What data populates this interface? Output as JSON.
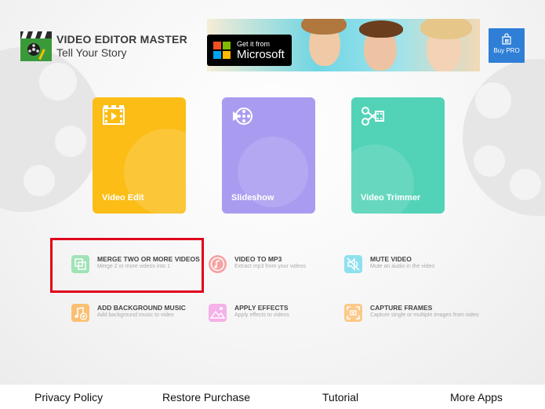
{
  "header": {
    "title": "VIDEO EDITOR MASTER",
    "subtitle": "Tell Your Story",
    "banner": {
      "line1": "Get it from",
      "line2": "Microsoft"
    },
    "buy_pro": "Buy PRO"
  },
  "tiles": [
    {
      "label": "Video Edit",
      "color": "#fbbd16"
    },
    {
      "label": "Slideshow",
      "color": "#a99cf0"
    },
    {
      "label": "Video Trimmer",
      "color": "#52d3b7"
    }
  ],
  "options": [
    {
      "title": "MERGE TWO OR MORE VIDEOS",
      "desc": "Merge 2 or more videos into 1",
      "color": "#9fe3b7"
    },
    {
      "title": "VIDEO TO MP3",
      "desc": "Extract mp3 from your videos",
      "color": "#f7a3a3"
    },
    {
      "title": "MUTE VIDEO",
      "desc": "Mute an audio in the video",
      "color": "#8fe0ef"
    },
    {
      "title": "ADD BACKGROUND MUSIC",
      "desc": "Add background music to video",
      "color": "#fbbf73"
    },
    {
      "title": "APPLY EFFECTS",
      "desc": "Apply effects to videos",
      "color": "#f5b1e8"
    },
    {
      "title": "CAPTURE FRAMES",
      "desc": "Capture single or multiple images from video",
      "color": "#fbc98a"
    }
  ],
  "footer": {
    "privacy": "Privacy Policy",
    "restore": "Restore Purchase",
    "tutorial": "Tutorial",
    "more_apps": "More Apps"
  },
  "colors": {
    "highlight": "#e0001b",
    "buy_pro_bg": "#2f7fd6"
  }
}
